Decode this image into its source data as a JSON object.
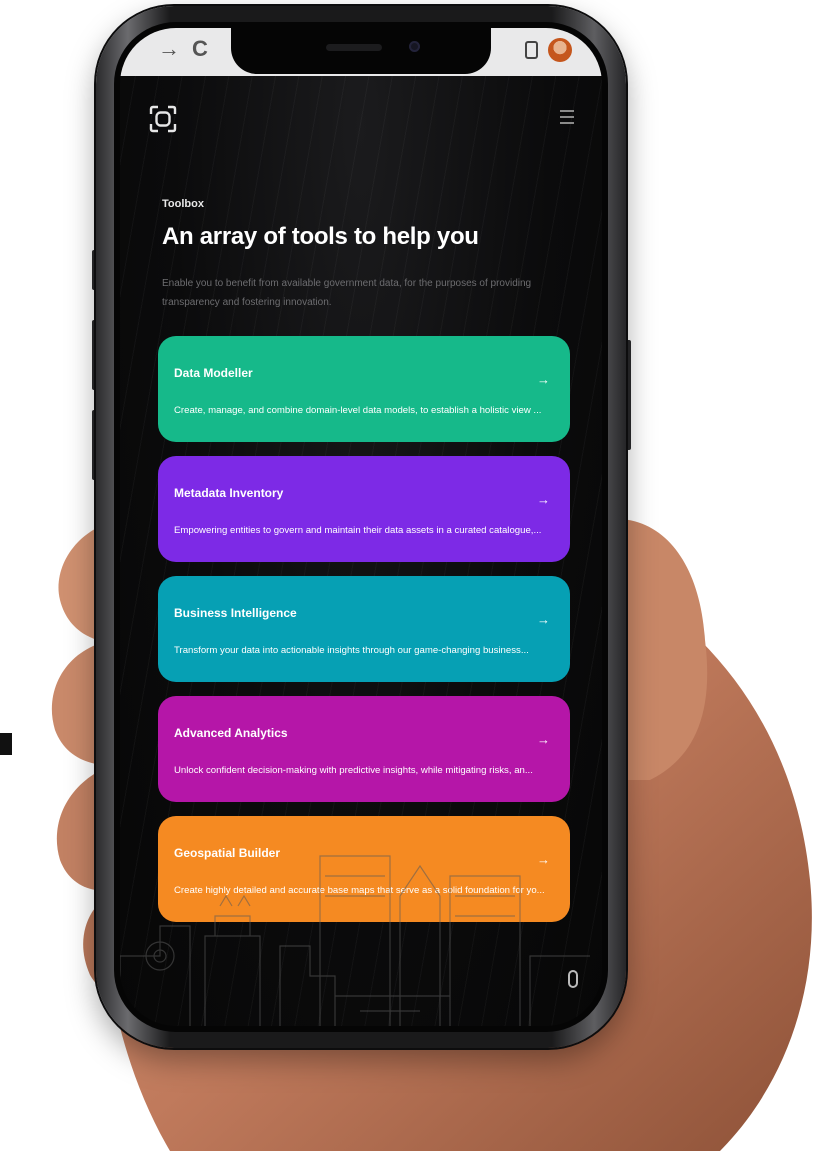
{
  "browser": {
    "back_glyph": "→",
    "reload_glyph": "C"
  },
  "header": {
    "logo_icon": "scan-frame-icon",
    "menu_icon": "hamburger-menu-icon"
  },
  "hero": {
    "eyebrow": "Toolbox",
    "title": "An array of tools to help you",
    "description": "Enable you to benefit from available government data, for the purposes of providing transparency and fostering innovation."
  },
  "cards": [
    {
      "title": "Data Modeller",
      "description": "Create, manage, and combine domain-level data models, to establish a holistic view ...",
      "color": "#16b98a",
      "arrow": "→"
    },
    {
      "title": "Metadata Inventory",
      "description": "Empowering entities to govern and maintain their data assets in a curated catalogue,...",
      "color": "#7d2ae6",
      "arrow": "→"
    },
    {
      "title": "Business Intelligence",
      "description": "Transform your data into actionable insights through our game-changing business...",
      "color": "#06a0b4",
      "arrow": "→"
    },
    {
      "title": "Advanced Analytics",
      "description": "Unlock confident decision-making with predictive insights, while mitigating risks, an...",
      "color": "#b516a8",
      "arrow": "→"
    },
    {
      "title": "Geospatial Builder",
      "description": "Create highly detailed and accurate base maps that serve as a solid foundation for yo...",
      "color": "#f58a22",
      "arrow": "→"
    }
  ],
  "colors": {
    "background": "#0b0b0c",
    "browser_bar": "#e9e9ea",
    "skin": "#c9876a"
  }
}
